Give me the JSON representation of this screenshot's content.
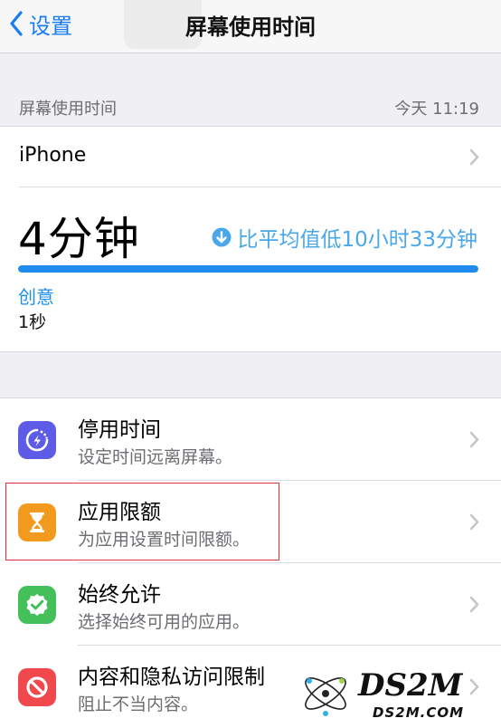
{
  "nav": {
    "back_label": "设置",
    "title": "屏幕使用时间"
  },
  "summary": {
    "header_label": "屏幕使用时间",
    "header_date": "今天 11:19",
    "device": "iPhone",
    "total_time": "4分钟",
    "comparison": "比平均值低10小时33分钟",
    "usage_bar_fraction": 1.0,
    "category": {
      "name": "创意",
      "time": "1秒"
    }
  },
  "settings": {
    "items": [
      {
        "title": "停用时间",
        "subtitle": "设定时间远离屏幕。",
        "icon": "downtime-icon",
        "icon_color": "#5e5ce6"
      },
      {
        "title": "应用限额",
        "subtitle": "为应用设置时间限额。",
        "icon": "hourglass-icon",
        "icon_color": "#f29a1d"
      },
      {
        "title": "始终允许",
        "subtitle": "选择始终可用的应用。",
        "icon": "checkmark-badge-icon",
        "icon_color": "#43c05a"
      },
      {
        "title": "内容和隐私访问限制",
        "subtitle": "阻止不当内容。",
        "icon": "restriction-icon",
        "icon_color": "#f0484d"
      }
    ]
  },
  "watermark": {
    "brand": "DS2M",
    "site": "DS2M.COM"
  },
  "colors": {
    "accent_blue": "#1a7cf5",
    "highlight_red": "#d9353f"
  }
}
